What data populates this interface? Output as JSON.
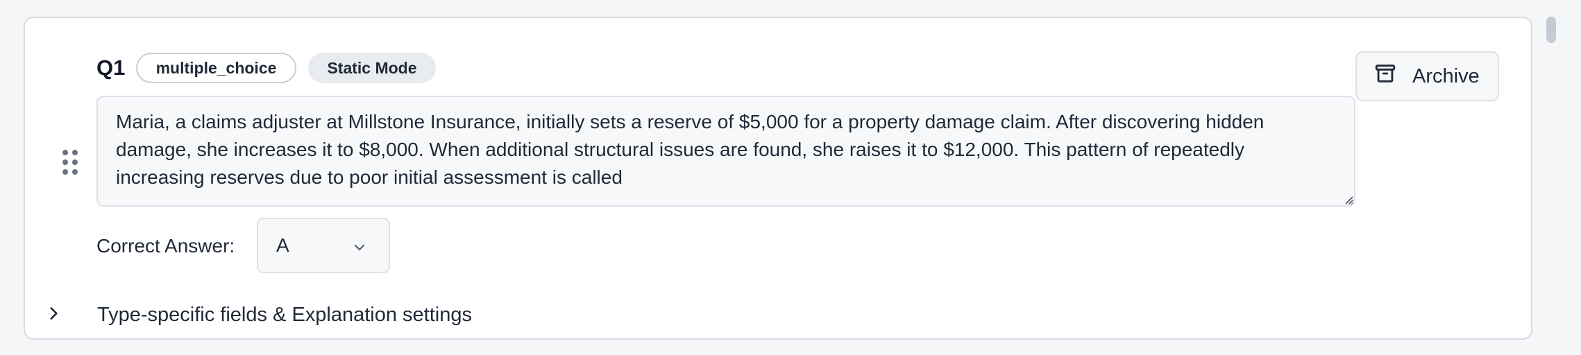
{
  "question": {
    "number": "Q1",
    "type_badge": "multiple_choice",
    "mode_badge": "Static Mode",
    "text": "Maria, a claims adjuster at Millstone Insurance, initially sets a reserve of $5,000 for a property damage claim. After discovering hidden damage, she increases it to $8,000. When additional structural issues are found, she raises it to $12,000. This pattern of repeatedly increasing reserves due to poor initial assessment is called"
  },
  "actions": {
    "archive_label": "Archive",
    "archive_icon": "archive-box-icon"
  },
  "answer": {
    "label": "Correct Answer:",
    "selected": "A"
  },
  "expander": {
    "label": "Type-specific fields & Explanation settings",
    "icon": "chevron-right-icon"
  },
  "colors": {
    "card_border": "#d6dbe3",
    "field_bg": "#f7f8fa",
    "pill_bg": "#e8ebef",
    "text": "#1f2937"
  }
}
